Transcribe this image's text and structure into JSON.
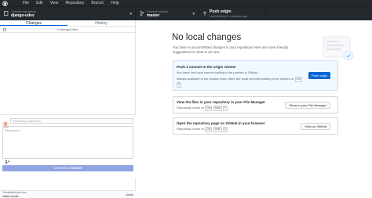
{
  "menu": [
    "File",
    "Edit",
    "View",
    "Repository",
    "Branch",
    "Help"
  ],
  "toolbar": {
    "repo_label": "Current repository",
    "repo_name": "django-udes",
    "branch_label": "Current branch",
    "branch_name": "master",
    "push_label": "Push origin",
    "push_sub": "Last fetched 2 minutes ago"
  },
  "sidebar": {
    "tabs": [
      "Changes",
      "History"
    ],
    "changed_files": "0 changed files",
    "summary_placeholder": "Summary (required)",
    "description_placeholder": "Description",
    "commit_button_prefix": "Commit to",
    "commit_button_branch": "master",
    "last_commit_label": "Committed just now",
    "last_commit_title": "Initial commit",
    "undo_label": "Undo"
  },
  "main": {
    "heading": "No local changes",
    "intro": "You have no uncommitted changes in your repository! Here are some friendly suggestions for what to do next.",
    "cards": {
      "push": {
        "title": "Push 1 commit to the origin remote",
        "desc": "You have one local commit waiting to be pushed to GitHub",
        "hint": "Always available in the toolbar when there are local commits waiting to be pushed or",
        "keys": [
          "Ctrl",
          "P"
        ],
        "button": "Push origin"
      },
      "files": {
        "title": "View the files in your repository in your File Manager",
        "menu": "Repository menu or",
        "keys": [
          "Ctrl",
          "Shift",
          "F"
        ],
        "button": "Show in your File Manager"
      },
      "browser": {
        "title": "Open the repository page on GitHub in your browser",
        "menu": "Repository menu or",
        "keys": [
          "Ctrl",
          "Shift",
          "G"
        ],
        "button": "View on GitHub"
      }
    }
  }
}
